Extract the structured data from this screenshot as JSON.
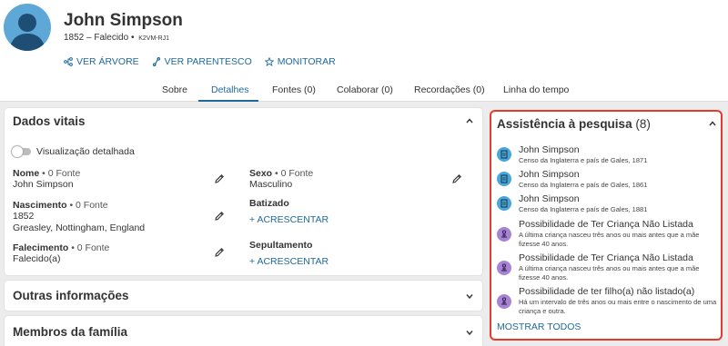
{
  "person": {
    "name": "John Simpson",
    "lifespan": "1852 – Falecido •",
    "pid": "K2VM-RJ1"
  },
  "actions": [
    {
      "label": "VER ÁRVORE",
      "icon": "tree-icon"
    },
    {
      "label": "VER PARENTESCO",
      "icon": "relationship-icon"
    },
    {
      "label": "MONITORAR",
      "icon": "star-icon"
    }
  ],
  "tabs": [
    {
      "label": "Sobre"
    },
    {
      "label": "Detalhes",
      "active": true
    },
    {
      "label": "Fontes (0)"
    },
    {
      "label": "Colaborar (0)"
    },
    {
      "label": "Recordações (0)"
    },
    {
      "label": "Linha do tempo"
    }
  ],
  "vitals": {
    "title": "Dados vitais",
    "toggle_label": "Visualização detalhada",
    "name": {
      "label": "Nome",
      "sources": " • 0 Fonte",
      "value": "John Simpson"
    },
    "sex": {
      "label": "Sexo",
      "sources": " • 0 Fonte",
      "value": "Masculino"
    },
    "birth": {
      "label": "Nascimento",
      "sources": " • 0 Fonte",
      "date": "1852",
      "place": "Greasley, Nottingham, England"
    },
    "christening": {
      "label": "Batizado",
      "add": "+  ACRESCENTAR"
    },
    "death": {
      "label": "Falecimento",
      "sources": " • 0 Fonte",
      "value": "Falecido(a)"
    },
    "burial": {
      "label": "Sepultamento",
      "add": "+  ACRESCENTAR"
    }
  },
  "other_info": {
    "title": "Outras informações"
  },
  "family": {
    "title": "Membros da família"
  },
  "research": {
    "title": "Assistência à pesquisa",
    "count": "(8)",
    "hints": [
      {
        "type": "record",
        "title": "John Simpson",
        "subtitle": "Censo da Inglaterra e país de Gales, 1871"
      },
      {
        "type": "record",
        "title": "John Simpson",
        "subtitle": "Censo da Inglaterra e país de Gales, 1861"
      },
      {
        "type": "record",
        "title": "John Simpson",
        "subtitle": "Censo da Inglaterra e país de Gales, 1881"
      },
      {
        "type": "person",
        "title": "Possibilidade de Ter Criança Não Listada",
        "subtitle": "A última criança nasceu três anos ou mais antes que a mãe fizesse 40 anos."
      },
      {
        "type": "person",
        "title": "Possibilidade de Ter Criança Não Listada",
        "subtitle": "A última criança nasceu três anos ou mais antes que a mãe fizesse 40 anos."
      },
      {
        "type": "person",
        "title": "Possibilidade de ter filho(a) não listado(a)",
        "subtitle": "Há um intervalo de três anos ou mais entre o nascimento de uma criança e outra."
      }
    ],
    "show_all": "MOSTRAR TODOS"
  },
  "colors": {
    "accent": "#1e6a9d",
    "highlight": "#e53a2f",
    "record_icon": "#4aa7d8",
    "person_icon": "#a784d3"
  }
}
